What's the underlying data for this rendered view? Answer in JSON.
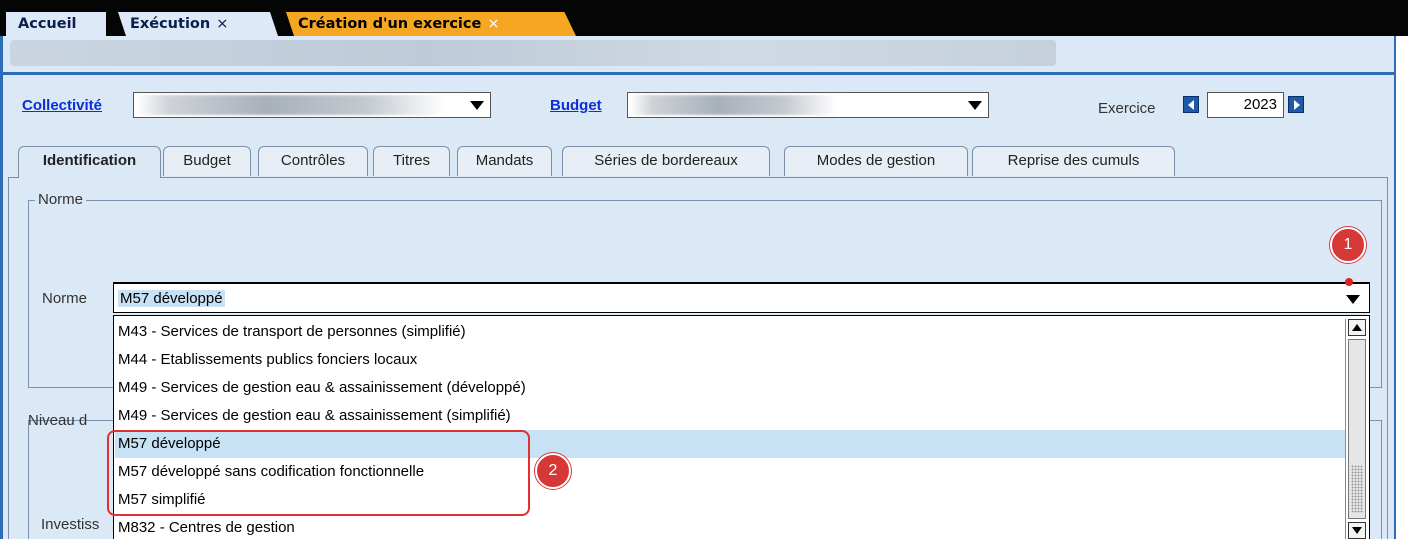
{
  "top_tabs": [
    {
      "label": "Accueil"
    },
    {
      "label": "Exécution",
      "close": "×"
    },
    {
      "label": "Création d'un exercice",
      "close": "×"
    }
  ],
  "header": {
    "collectivite_label": "Collectivité",
    "budget_label": "Budget",
    "exercice_label": "Exercice",
    "exercice_value": "2023"
  },
  "tabs": [
    {
      "label": "Identification"
    },
    {
      "label": "Budget"
    },
    {
      "label": "Contrôles"
    },
    {
      "label": "Titres"
    },
    {
      "label": "Mandats"
    },
    {
      "label": "Séries de bordereaux"
    },
    {
      "label": "Modes de gestion"
    },
    {
      "label": "Reprise des cumuls"
    }
  ],
  "norme_group": {
    "title": "Norme",
    "label": "Norme",
    "selected": "M57 développé"
  },
  "niveau_group": {
    "title_partial": "Niveau d",
    "investiss_partial": "Investiss"
  },
  "dropdown_options": [
    "M43 - Services de transport de personnes (simplifié)",
    "M44 - Etablissements publics fonciers locaux",
    "M49 - Services de gestion eau & assainissement (développé)",
    "M49 - Services de gestion eau & assainissement (simplifié)",
    "M57 développé",
    "M57 développé sans codification fonctionnelle",
    "M57 simplifié",
    "M832 - Centres de gestion"
  ],
  "annotations": {
    "marker1": "1",
    "marker2": "2"
  },
  "colors": {
    "accent_tab": "#f5a623",
    "frame_blue": "#2e6db5",
    "selection": "#c7e1f5",
    "annotation_red": "#d63838"
  }
}
